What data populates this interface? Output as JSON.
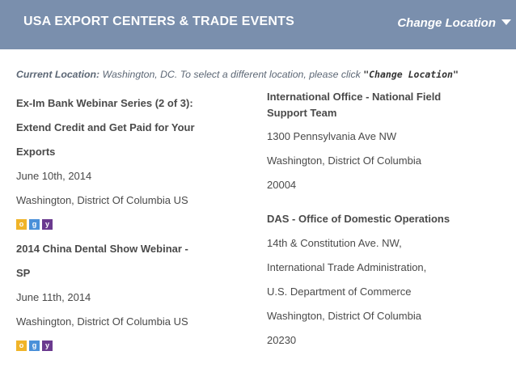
{
  "header": {
    "title": "USA EXPORT CENTERS & TRADE EVENTS",
    "change_location": "Change Location"
  },
  "current_location": {
    "label": "Current Location:",
    "text": " Washington, DC. To select a different location, please click ",
    "link": "\"Change Location\""
  },
  "events": [
    {
      "title_lines": [
        "Ex-Im Bank Webinar Series (2 of 3):",
        "Extend Credit and Get Paid for Your",
        "Exports"
      ],
      "date": "June 10th, 2014",
      "location": "Washington, District Of Columbia US",
      "icons": [
        "o",
        "g",
        "y"
      ]
    },
    {
      "title_lines": [
        "2014 China Dental Show Webinar -",
        "SP"
      ],
      "date": "June 11th, 2014",
      "location": "Washington, District Of Columbia US",
      "icons": [
        "o",
        "g",
        "y"
      ]
    }
  ],
  "offices": [
    {
      "title_lines": [
        "International Office - National Field",
        "Support Team"
      ],
      "address_lines": [
        "1300 Pennsylvania Ave NW",
        "Washington, District Of Columbia",
        "20004"
      ]
    },
    {
      "title_lines": [
        "DAS - Office of Domestic Operations"
      ],
      "address_lines": [
        "14th & Constitution Ave. NW,",
        "International Trade Administration,",
        "U.S. Department of Commerce",
        "Washington, District Of Columbia",
        "20230"
      ]
    }
  ],
  "colors": {
    "header_bg": "#7a8fad",
    "link": "#6d829f",
    "outlook": "#f0b429",
    "google": "#4a90d9",
    "yahoo": "#6b3a8f"
  }
}
